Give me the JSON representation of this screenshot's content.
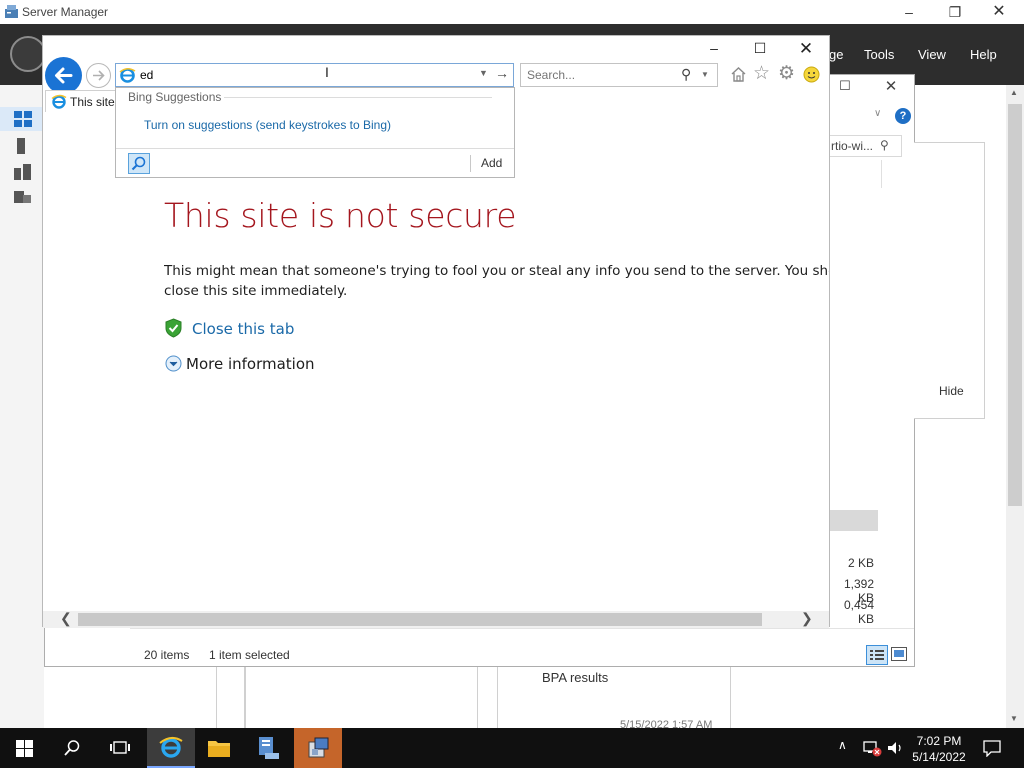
{
  "server_manager": {
    "title": "Server Manager",
    "menu": {
      "manage": "ge",
      "tools": "Tools",
      "view": "View",
      "help": "Help"
    }
  },
  "explorer": {
    "address_tail": "rtio-wi...",
    "hide_label": "Hide",
    "file_sizes": [
      "2 KB",
      "1,392 KB",
      "0,454 KB"
    ],
    "status": {
      "items": "20 items",
      "selected": "1 item selected"
    }
  },
  "bpa": {
    "results_label": "BPA results",
    "timestamp": "5/15/2022 1:57 AM"
  },
  "ie": {
    "address_value": "ed",
    "search_placeholder": "Search...",
    "tab_label": "This site",
    "dropdown": {
      "header": "Bing Suggestions",
      "suggestion_link": "Turn on suggestions (send keystrokes to Bing)",
      "add_label": "Add"
    },
    "page": {
      "title": "This site is not secure",
      "body_line1": "This might mean that someone's trying to fool you or steal any info you send to the server. You shou",
      "body_line2": "close this site immediately.",
      "close_tab_link": "Close this tab",
      "more_info": "More information"
    }
  },
  "taskbar": {
    "time": "7:02 PM",
    "date": "5/14/2022"
  },
  "colors": {
    "error_red": "#a4161e",
    "link_blue": "#1a69a8",
    "ie_blue": "#1a73d4",
    "sm_header": "#2d2d2d",
    "taskbar": "#101010"
  }
}
